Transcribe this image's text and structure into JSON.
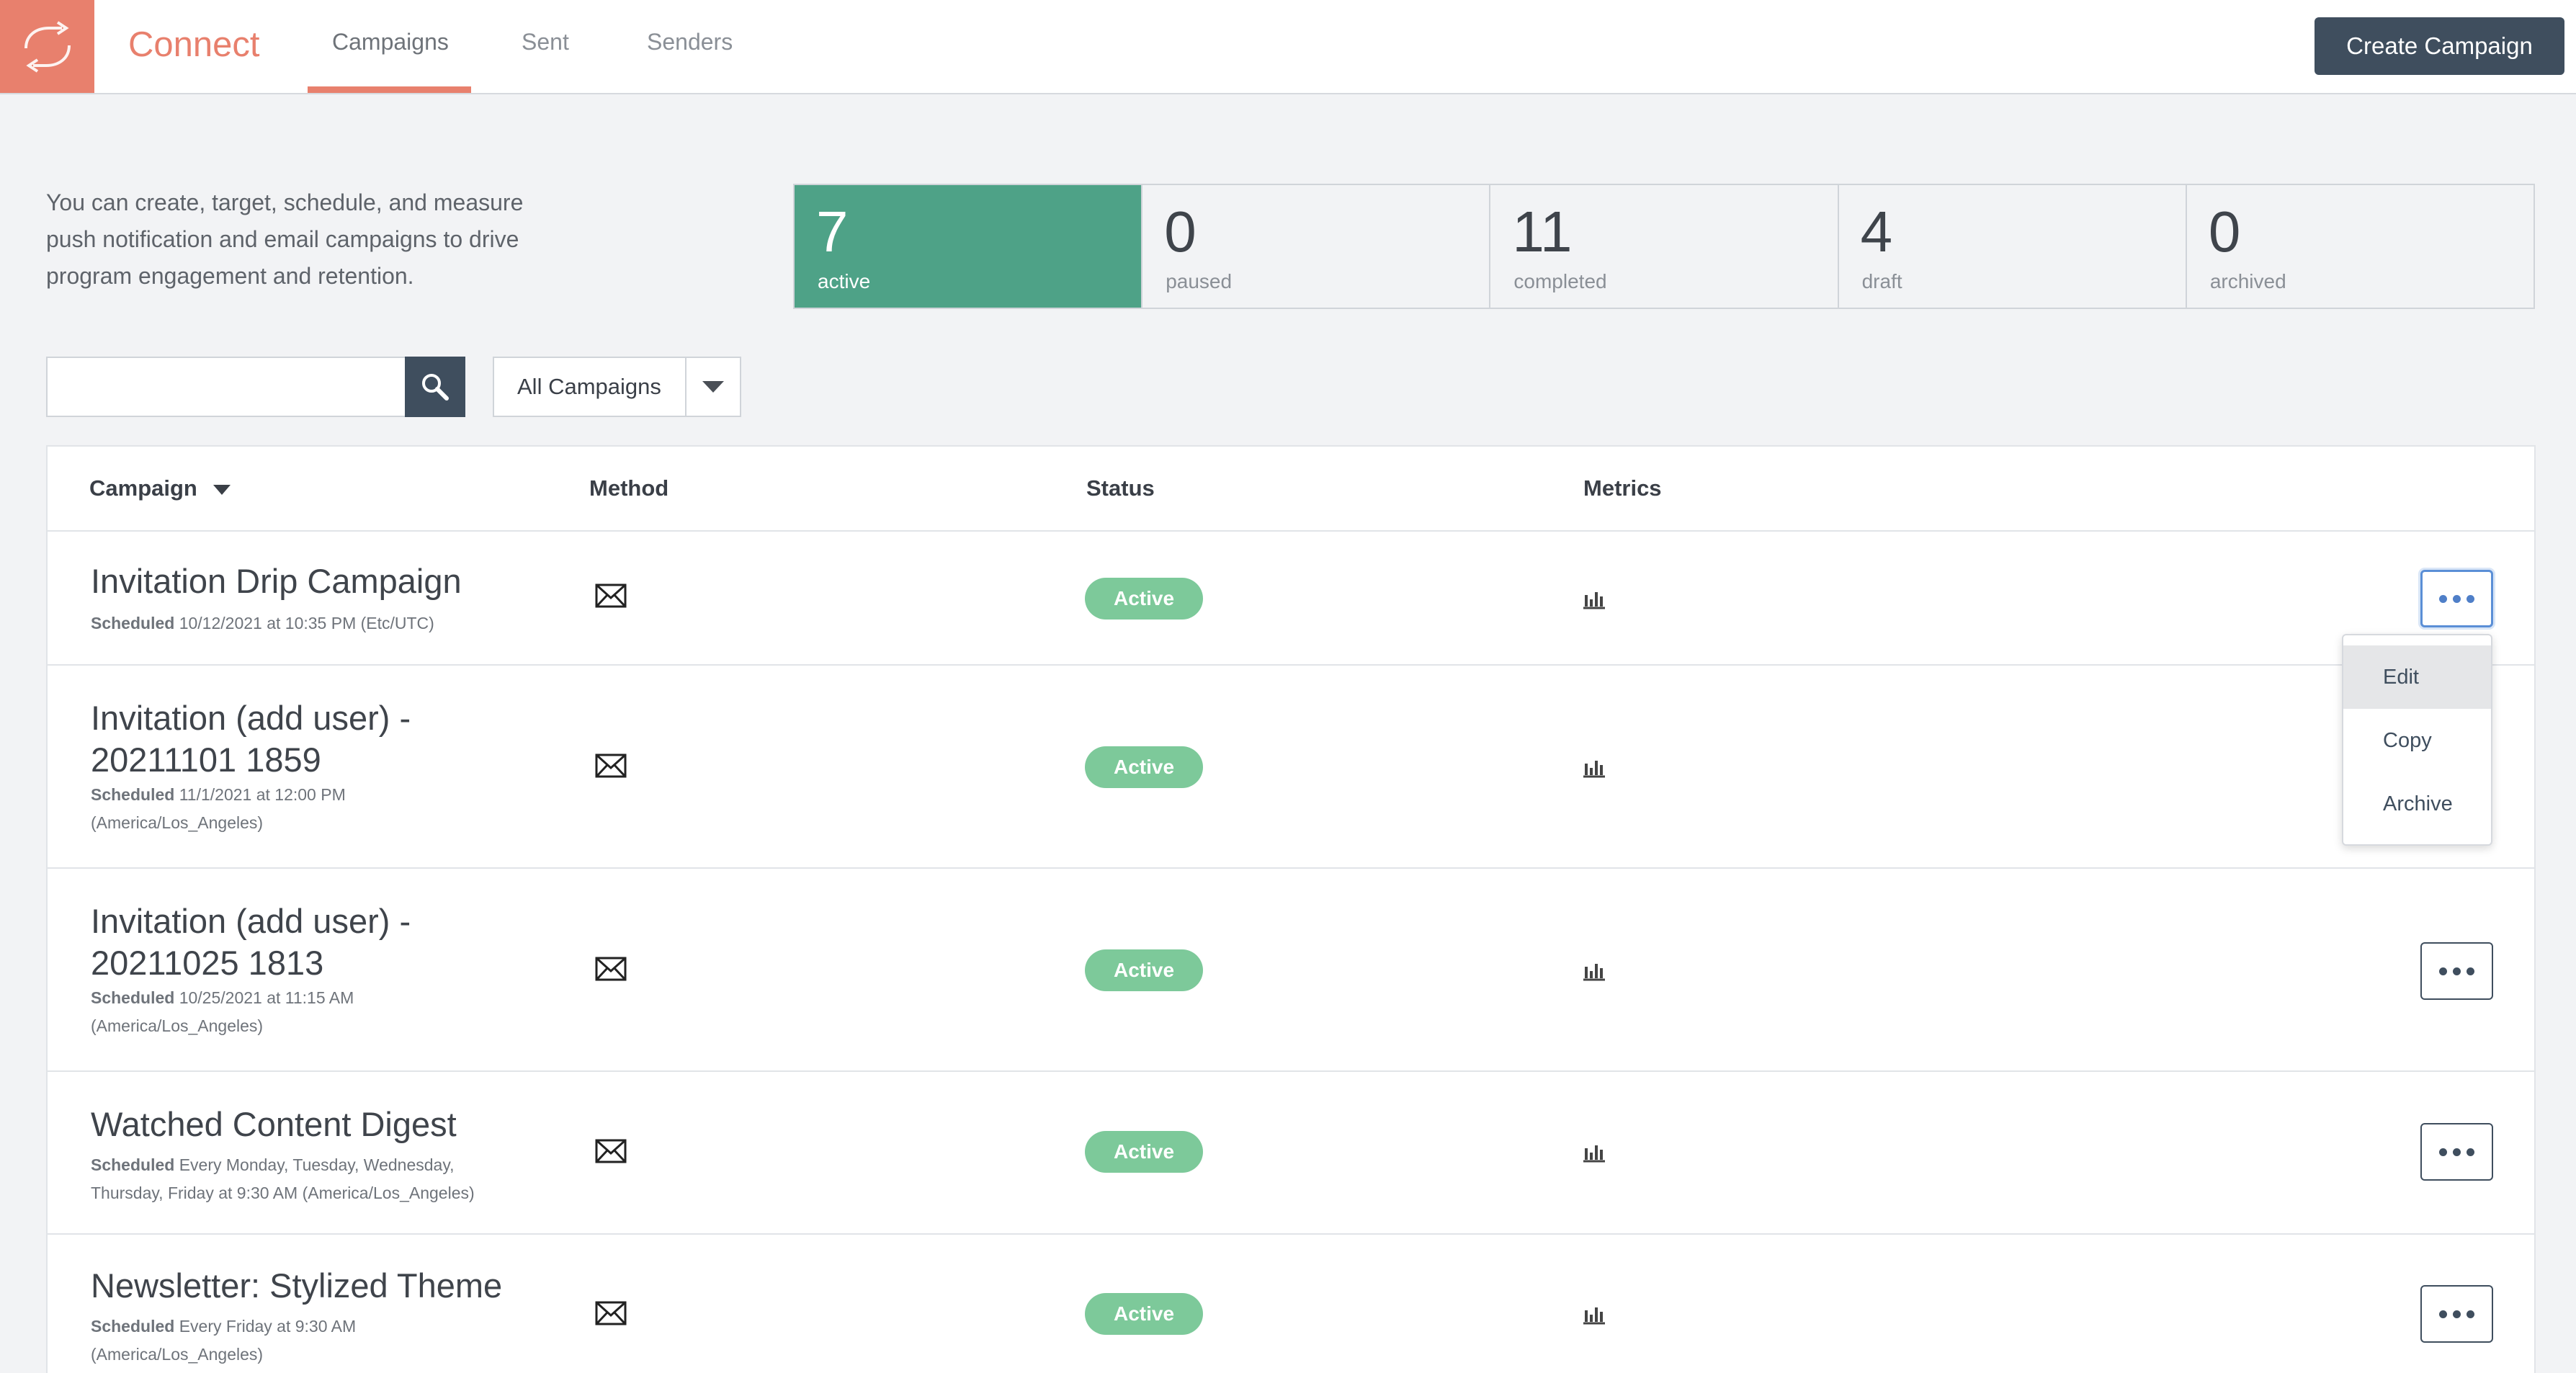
{
  "app": {
    "name": "Connect"
  },
  "nav": {
    "tabs": [
      {
        "label": "Campaigns"
      },
      {
        "label": "Sent"
      },
      {
        "label": "Senders"
      }
    ]
  },
  "header": {
    "create_label": "Create Campaign"
  },
  "intro": "You can create, target, schedule, and measure push notification and email campaigns to drive program engagement and retention.",
  "stats": [
    {
      "value": "7",
      "label": "active"
    },
    {
      "value": "0",
      "label": "paused"
    },
    {
      "value": "11",
      "label": "completed"
    },
    {
      "value": "4",
      "label": "draft"
    },
    {
      "value": "0",
      "label": "archived"
    }
  ],
  "filter": {
    "selected": "All Campaigns"
  },
  "table": {
    "columns": [
      {
        "label": "Campaign"
      },
      {
        "label": "Method"
      },
      {
        "label": "Status"
      },
      {
        "label": "Metrics"
      }
    ],
    "rows": [
      {
        "name": "Invitation Drip Campaign",
        "scheduled_label": "Scheduled",
        "schedule": " 10/12/2021 at 10:35 PM (Etc/UTC)",
        "status": "Active"
      },
      {
        "name": "Invitation (add user) - 20211101 1859",
        "scheduled_label": "Scheduled",
        "schedule": " 11/1/2021 at 12:00 PM (America/Los_Angeles)",
        "status": "Active"
      },
      {
        "name": "Invitation (add user) - 20211025 1813",
        "scheduled_label": "Scheduled",
        "schedule": " 10/25/2021 at 11:15 AM (America/Los_Angeles)",
        "status": "Active"
      },
      {
        "name": "Watched Content Digest",
        "scheduled_label": "Scheduled",
        "schedule": " Every Monday, Tuesday, Wednesday, Thursday, Friday at 9:30 AM (America/Los_Angeles)",
        "status": "Active"
      },
      {
        "name": "Newsletter: Stylized Theme",
        "scheduled_label": "Scheduled",
        "schedule": " Every Friday at 9:30 AM (America/Los_Angeles)",
        "status": "Active"
      }
    ]
  },
  "menu": {
    "items": [
      {
        "label": "Edit"
      },
      {
        "label": "Copy"
      },
      {
        "label": "Archive"
      }
    ]
  },
  "colors": {
    "brand": "#e8806d",
    "active_stat": "#4ea287",
    "badge": "#7dc99a",
    "navy": "#3f4e5e"
  },
  "icons": {
    "logo": "sync-arrows-icon",
    "search": "search-icon",
    "method": "envelope-icon",
    "metrics": "bar-chart-icon",
    "more": "more-dots-icon",
    "sort": "caret-down-icon"
  }
}
